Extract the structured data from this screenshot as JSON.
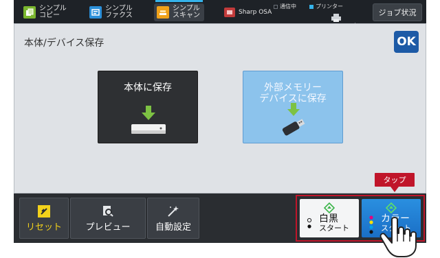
{
  "topbar": {
    "tabs": [
      {
        "line1": "シンプル",
        "line2": "コピー",
        "icon": "copy-icon"
      },
      {
        "line1": "シンプル",
        "line2": "ファクス",
        "icon": "fax-icon"
      },
      {
        "line1": "シンプル",
        "line2": "スキャン",
        "icon": "scan-icon",
        "active": true
      },
      {
        "line1": "Sharp OSA",
        "icon": "osa-icon"
      }
    ],
    "status_communicating": "通信中",
    "status_printer": "プリンター",
    "job_status_label": "ジョブ状況"
  },
  "main": {
    "title": "本体/デバイス保存",
    "ok_label": "OK",
    "save_local_label": "本体に保存",
    "save_external_line1": "外部メモリー",
    "save_external_line2": "デバイスに保存"
  },
  "bottombar": {
    "reset_label": "リセット",
    "preview_label": "プレビュー",
    "auto_setting_label": "自動設定",
    "bw_start_main": "白黒",
    "bw_start_sub": "スタート",
    "color_start_main": "カラー",
    "color_start_sub": "スタート"
  },
  "callout": {
    "tap_label": "タップ"
  },
  "colors": {
    "accent_blue": "#1d5aa6",
    "highlight_red": "#c0152a",
    "reset_yellow": "#f3d21b"
  }
}
